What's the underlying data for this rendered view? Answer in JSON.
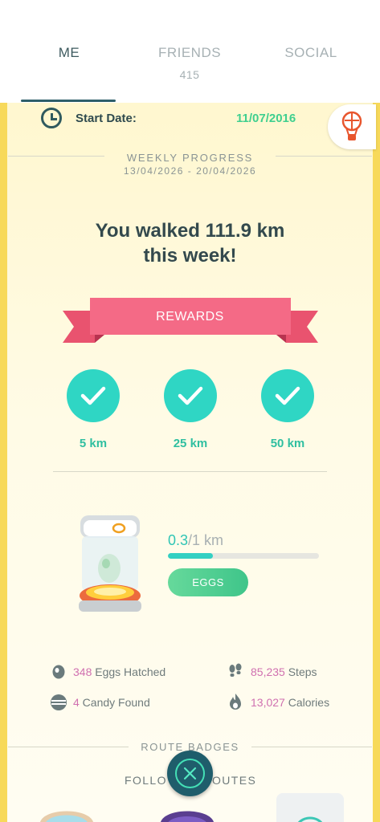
{
  "tabs": [
    {
      "label": "ME",
      "count": ""
    },
    {
      "label": "FRIENDS",
      "count": "415"
    },
    {
      "label": "SOCIAL",
      "count": ""
    }
  ],
  "start": {
    "label": "Start Date:",
    "date": "11/07/2016"
  },
  "weekly": {
    "title": "WEEKLY PROGRESS",
    "range": "13/04/2026 - 20/04/2026"
  },
  "walked": {
    "line1": "You walked 111.9 km",
    "line2": "this week!"
  },
  "rewards": {
    "banner": "REWARDS",
    "items": [
      {
        "label": "5 km",
        "claimed": true
      },
      {
        "label": "25 km",
        "claimed": true
      },
      {
        "label": "50 km",
        "claimed": true
      }
    ]
  },
  "egg": {
    "progress_value": "0.3",
    "progress_total": "/1 km",
    "progress_fraction": 0.3,
    "button": "EGGS"
  },
  "stats": {
    "eggs_num": "348",
    "eggs_label": " Eggs Hatched",
    "steps_num": "85,235",
    "steps_label": " Steps",
    "candy_num": "4",
    "candy_label": " Candy Found",
    "cal_num": "13,027",
    "cal_label": " Calories"
  },
  "routes": {
    "title": "ROUTE BADGES",
    "follow_a": "FOLLO",
    "follow_b": "OUTES"
  },
  "colors": {
    "accent": "#2fd6c4",
    "ribbon": "#f06b85",
    "date": "#3fcf8f",
    "stat_number": "#d070b0"
  }
}
